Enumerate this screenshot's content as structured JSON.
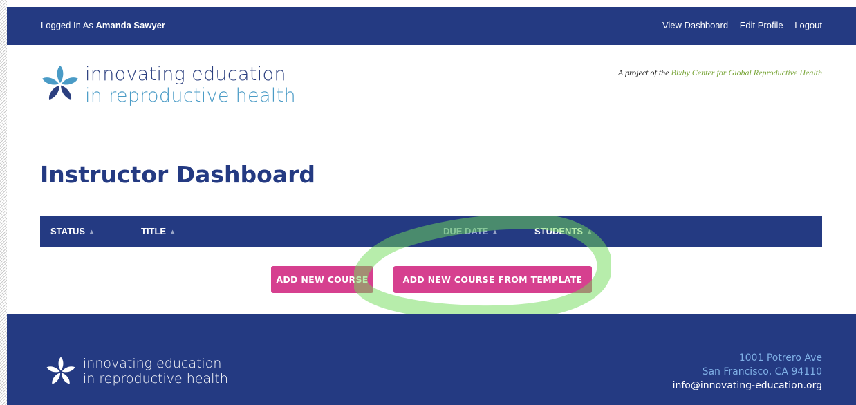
{
  "header": {
    "logged_in_prefix": "Logged In As",
    "user_name": "Amanda Sawyer",
    "nav": {
      "view_dashboard": "View Dashboard",
      "edit_profile": "Edit Profile",
      "logout": "Logout"
    }
  },
  "brand": {
    "line1": "innovating education",
    "line2": "in reproductive health",
    "icon": "flower-logo-icon"
  },
  "project": {
    "prefix": "A project of the",
    "link": "Bixby Center for Global Reproductive Health"
  },
  "page": {
    "title": "Instructor Dashboard"
  },
  "table": {
    "columns": [
      "STATUS",
      "TITLE",
      "DUE DATE",
      "STUDENTS"
    ],
    "sort_icon": "sort-icon"
  },
  "buttons": {
    "add_course": "ADD NEW COURSE",
    "add_from_template": "ADD NEW COURSE FROM TEMPLATE"
  },
  "footer": {
    "address_line1": "1001 Potrero Ave",
    "address_line2": "San Francisco, CA 94110",
    "email": "info@innovating-education.org"
  },
  "colors": {
    "navy": "#243a82",
    "pink_button": "#d6408f",
    "logo_blue": "#4a9bc6",
    "highlight_green": "#6fdc58",
    "divider": "#b45aa8"
  }
}
